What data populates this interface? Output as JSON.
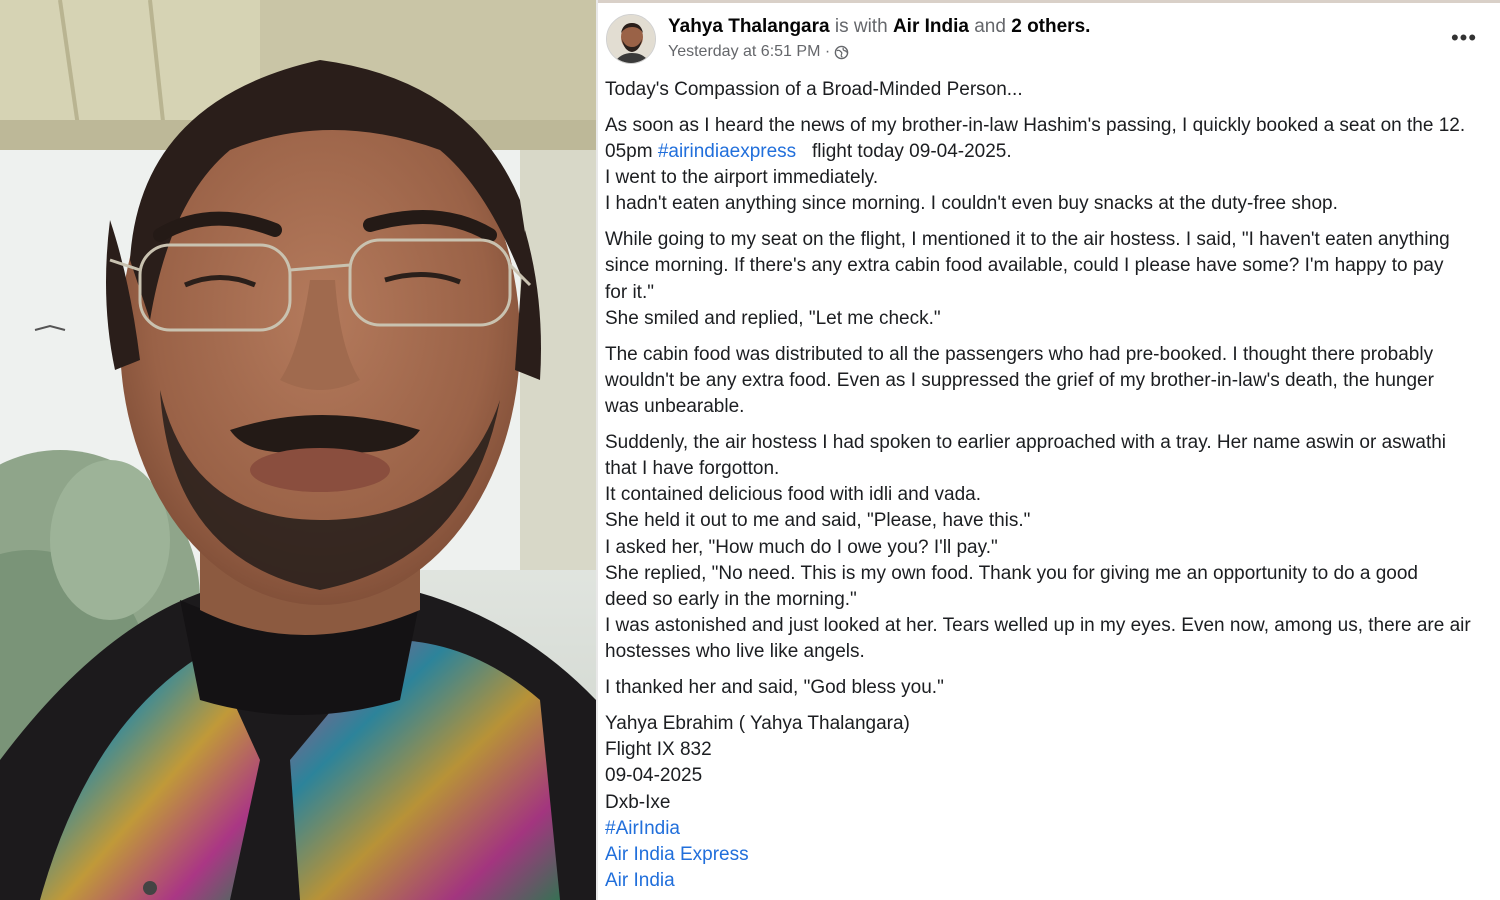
{
  "post": {
    "author": "Yahya Thalangara",
    "with_text": "is with",
    "tagged_1": "Air India",
    "and_text": "and",
    "tagged_others": "2 others.",
    "timestamp": "Yesterday at 6:51 PM ·",
    "more_label": "•••",
    "paragraphs": {
      "p1": [
        "Today's Compassion of a Broad-Minded Person..."
      ],
      "p2": {
        "l1": "As soon as I heard the news of my brother-in-law Hashim's passing, I quickly booked a seat on the 12.",
        "l2_pre": "05pm ",
        "l2_link": "#airindiaexpress",
        "l2_post": "   flight today 09-04-2025.",
        "l3": "I went to the airport immediately.",
        "l4": "I hadn't eaten anything since morning. I couldn't even buy snacks at the duty-free shop."
      },
      "p3": [
        "While going to my seat on the flight, I mentioned it to the air hostess. I said, \"I haven't eaten anything",
        "since morning. If there's any extra cabin food available, could I please have some? I'm happy to pay",
        "for it.\"",
        "She smiled and replied, \"Let me check.\""
      ],
      "p4": [
        "The cabin food was distributed to all the passengers who had pre-booked. I thought there probably",
        "wouldn't be any extra food. Even as I suppressed the grief of my brother-in-law's death, the hunger",
        "was unbearable."
      ],
      "p5": [
        "Suddenly, the air hostess I had spoken to earlier approached with a tray. Her name aswin or aswathi",
        "that I have forgotton.",
        "It contained delicious food with idli and vada.",
        "She held it out to me and said, \"Please, have this.\"",
        "I asked her, \"How much do I owe you? I'll pay.\"",
        "She replied, \"No need. This is my own food. Thank you for giving me an opportunity to do a good",
        "deed so early in the morning.\"",
        "I was astonished and just looked at her. Tears welled up in my eyes.  Even now, among us, there are air",
        "hostesses who live like angels."
      ],
      "p6": [
        "I thanked her and said, \"God bless you.\""
      ],
      "p7": [
        "Yahya Ebrahim ( Yahya Thalangara)",
        "Flight IX 832",
        "09-04-2025",
        "Dxb-Ixe"
      ],
      "links": [
        "#AirIndia",
        "Air India Express",
        "Air India"
      ]
    }
  },
  "colors": {
    "link": "#216fdb",
    "text": "#1c1e21",
    "meta": "#65676b"
  },
  "icons": {
    "globe": "globe-icon",
    "avatar": "profile-photo",
    "more": "more-options-icon"
  }
}
